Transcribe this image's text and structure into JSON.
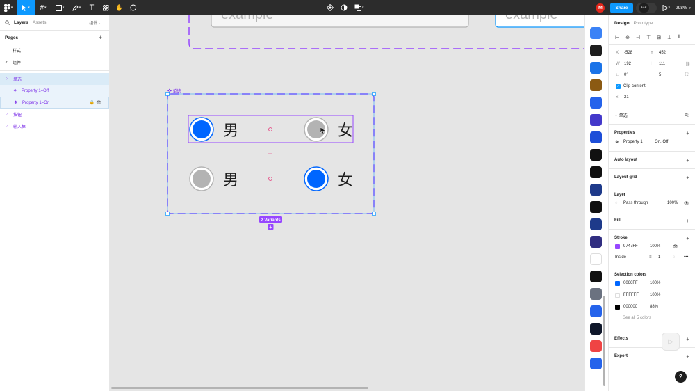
{
  "toolbar": {
    "zoom": "298%",
    "share_label": "Share",
    "user_initial": "M",
    "code_label": "</>"
  },
  "left_panel": {
    "tabs": [
      "Layers",
      "Assets"
    ],
    "page_dropdown": "组件",
    "pages_title": "Pages",
    "pages": [
      {
        "label": "样式",
        "current": false
      },
      {
        "label": "组件",
        "current": true
      }
    ],
    "layers": [
      {
        "label": "单选",
        "indent": 0
      },
      {
        "label": "Property 1=Off",
        "indent": 1
      },
      {
        "label": "Property 1=On",
        "indent": 1
      },
      {
        "label": "按钮",
        "indent": 0
      },
      {
        "label": "输入框",
        "indent": 0
      }
    ]
  },
  "canvas": {
    "input_placeholder_left": "example",
    "input_placeholder_right": "example",
    "component_set_label": "单选",
    "variants_badge": "2 Variants",
    "variant_on": {
      "label_a": "男",
      "label_b": "女",
      "a_selected": true,
      "b_selected": false
    },
    "variant_off": {
      "label_a": "男",
      "label_b": "女",
      "a_selected": false,
      "b_selected": true
    },
    "colors": {
      "selected": "#0066FF",
      "unselected": "#B3B3B3",
      "dashed_stroke": "#9747FF"
    }
  },
  "right_panel": {
    "tabs": [
      "Design",
      "Prototype"
    ],
    "x": "-528",
    "y": "452",
    "w": "192",
    "h": "111",
    "rotation": "0°",
    "radius": "5",
    "clip_content_label": "Clip content",
    "gap": "21",
    "component_name": "单选",
    "properties_title": "Properties",
    "property_name": "Property 1",
    "property_values": "On, Off",
    "auto_layout_title": "Auto layout",
    "layout_grid_title": "Layout grid",
    "layer_title": "Layer",
    "blend_mode": "Pass through",
    "layer_opacity": "100%",
    "fill_title": "Fill",
    "stroke_title": "Stroke",
    "stroke_color": "9747FF",
    "stroke_opacity": "100%",
    "stroke_position": "Inside",
    "stroke_weight": "1",
    "selection_colors_title": "Selection colors",
    "selection_colors": [
      {
        "hex": "0066FF",
        "opacity": "100%",
        "color": "#0066FF"
      },
      {
        "hex": "FFFFFF",
        "opacity": "100%",
        "color": "#FFFFFF"
      },
      {
        "hex": "000000",
        "opacity": "88%",
        "color": "#000000"
      }
    ],
    "see_all_colors": "See all 5 colors",
    "effects_title": "Effects",
    "export_title": "Export"
  },
  "plugins": [
    {
      "name": "component-icon",
      "bg": "#3b82f6"
    },
    {
      "name": "eye-plugin-icon",
      "bg": "#1e1e1e"
    },
    {
      "name": "doc-plugin-icon",
      "bg": "#1a73e8"
    },
    {
      "name": "gold-plugin-icon",
      "bg": "#8b5a12"
    },
    {
      "name": "zi-plugin-icon",
      "bg": "#2563eb"
    },
    {
      "name": "twitch-plugin-icon",
      "bg": "#4338ca"
    },
    {
      "name": "frame-plugin-icon",
      "bg": "#1d4ed8"
    },
    {
      "name": "figma-plugin-icon",
      "bg": "#111111"
    },
    {
      "name": "font-plugin-icon",
      "bg": "#111111"
    },
    {
      "name": "grid-plugin-icon",
      "bg": "#1e3a8a"
    },
    {
      "name": "arrows-plugin-icon",
      "bg": "#111111"
    },
    {
      "name": "dots-plugin-icon",
      "bg": "#1e3a8a"
    },
    {
      "name": "spark-plugin-icon",
      "bg": "#312e81"
    },
    {
      "name": "stamp-plugin-icon",
      "bg": "#ffffff"
    },
    {
      "name": "hand-plugin-icon",
      "bg": "#111111"
    },
    {
      "name": "user-plugin-icon",
      "bg": "#6b7280"
    },
    {
      "name": "pen-plugin-icon",
      "bg": "#2563eb"
    },
    {
      "name": "box-plugin-icon",
      "bg": "#0f172a"
    },
    {
      "name": "chart-plugin-icon",
      "bg": "#ef4444"
    },
    {
      "name": "truck-plugin-icon",
      "bg": "#2563eb"
    }
  ]
}
